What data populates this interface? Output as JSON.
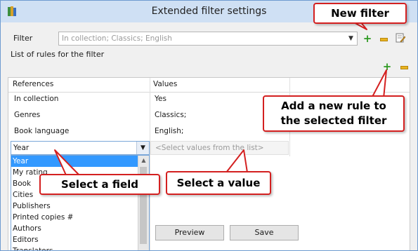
{
  "window": {
    "title": "Extended filter settings"
  },
  "filter": {
    "label": "Filter",
    "value": "In collection; Classics; English"
  },
  "rules_section_label": "List of rules for the filter",
  "grid": {
    "columns": [
      "References",
      "Values"
    ],
    "rows": [
      {
        "reference": "In collection",
        "value": "Yes"
      },
      {
        "reference": "Genres",
        "value": "Classics;"
      },
      {
        "reference": "Book language",
        "value": "English;"
      }
    ],
    "edit_field_value": "Year",
    "value_placeholder": "<Select values from the list>"
  },
  "field_dropdown": {
    "options": [
      "Year",
      "My rating",
      "Book",
      "Cities",
      "Publishers",
      "Printed copies #",
      "Authors",
      "Editors",
      "Translators"
    ],
    "selected": "Year"
  },
  "buttons": {
    "preview": "Preview",
    "save": "Save"
  },
  "callouts": {
    "new_filter": "New filter",
    "add_rule_line1": "Add a new rule to",
    "add_rule_line2": "the selected filter",
    "select_field": "Select a field",
    "select_value": "Select a value"
  },
  "colors": {
    "callout_border": "#d42020",
    "selection": "#3399ff",
    "add_green": "#2e9a22",
    "remove_yellow": "#e8b321"
  },
  "icons": [
    "app-books-icon",
    "add-icon",
    "remove-icon",
    "edit-note-icon",
    "chevron-down-icon"
  ]
}
